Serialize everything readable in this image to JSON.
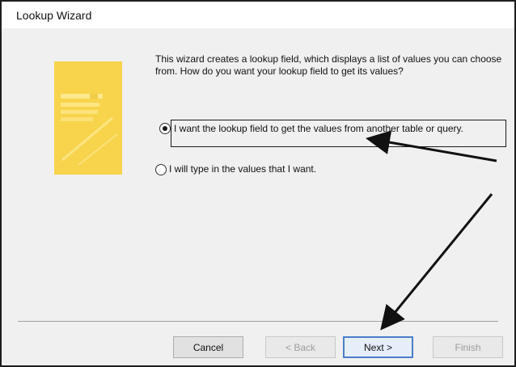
{
  "window": {
    "title": "Lookup Wizard"
  },
  "intro": {
    "text": "This wizard creates a lookup field, which displays a list of values you can choose from.  How do you want your lookup field to get its values?"
  },
  "options": [
    {
      "label": "I want the lookup field to get the values from another table or query.",
      "selected": true
    },
    {
      "label": "I will type in the values that I want.",
      "selected": false
    }
  ],
  "buttons": {
    "cancel": "Cancel",
    "back": "< Back",
    "next": "Next >",
    "finish": "Finish"
  },
  "colors": {
    "illustration": "#f7d23e",
    "arrow": "#111111"
  }
}
